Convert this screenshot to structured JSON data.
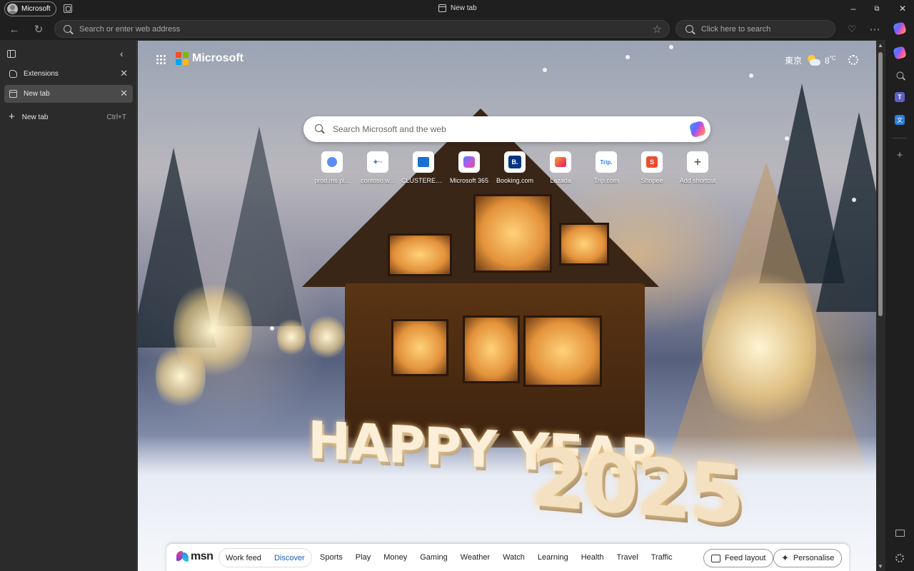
{
  "window": {
    "profile_label": "Microsoft",
    "title": "New tab",
    "controls": [
      "minimize-icon",
      "restore-icon",
      "close-icon"
    ]
  },
  "toolbar": {
    "address_placeholder": "Search or enter web address",
    "bing_placeholder": "Click here to search"
  },
  "tabs_pane": {
    "items": [
      {
        "label": "Extensions",
        "icon": "extensions-icon",
        "active": false
      },
      {
        "label": "New tab",
        "icon": "page-icon",
        "active": true
      }
    ],
    "new_tab_label": "New tab",
    "new_tab_shortcut": "Ctrl+T"
  },
  "page": {
    "brand": "Microsoft",
    "weather": {
      "city": "東京",
      "temp": "8",
      "unit": "°C"
    },
    "search_placeholder": "Search Microsoft and the web",
    "shortcuts": [
      {
        "label": "prod.ms.pl...",
        "icon": "circle-app-icon"
      },
      {
        "label": "contoso.w...",
        "icon": "dots-app-icon"
      },
      {
        "label": "CLUSTERED ...",
        "icon": "azure-icon"
      },
      {
        "label": "Microsoft 365",
        "icon": "m365-icon"
      },
      {
        "label": "Booking.com",
        "icon": "booking-icon",
        "glyph": "B."
      },
      {
        "label": "Lazada",
        "icon": "lazada-icon"
      },
      {
        "label": "Trip.com",
        "icon": "trip-icon",
        "glyph": "Trip."
      },
      {
        "label": "Shopee",
        "icon": "shopee-icon",
        "glyph": "S"
      },
      {
        "label": "Add shortcut",
        "icon": "plus-icon",
        "glyph": "+"
      }
    ],
    "greeting": "HAPPY YEAR",
    "year": "2025"
  },
  "msn": {
    "brand": "msn",
    "feed_tabs": [
      "Work feed",
      "Discover"
    ],
    "active_feed": "Discover",
    "nav": [
      "Sports",
      "Play",
      "Money",
      "Gaming",
      "Weather",
      "Watch",
      "Learning",
      "Health",
      "Travel",
      "Traffic"
    ],
    "feed_layout_label": "Feed layout",
    "personalise_label": "Personalise"
  },
  "colors": {
    "chrome_bg": "#1f1f1f",
    "pane_bg": "#2b2b2b",
    "active_tab_bg": "#4a4a4a",
    "msn_active": "#1a5fb4"
  }
}
